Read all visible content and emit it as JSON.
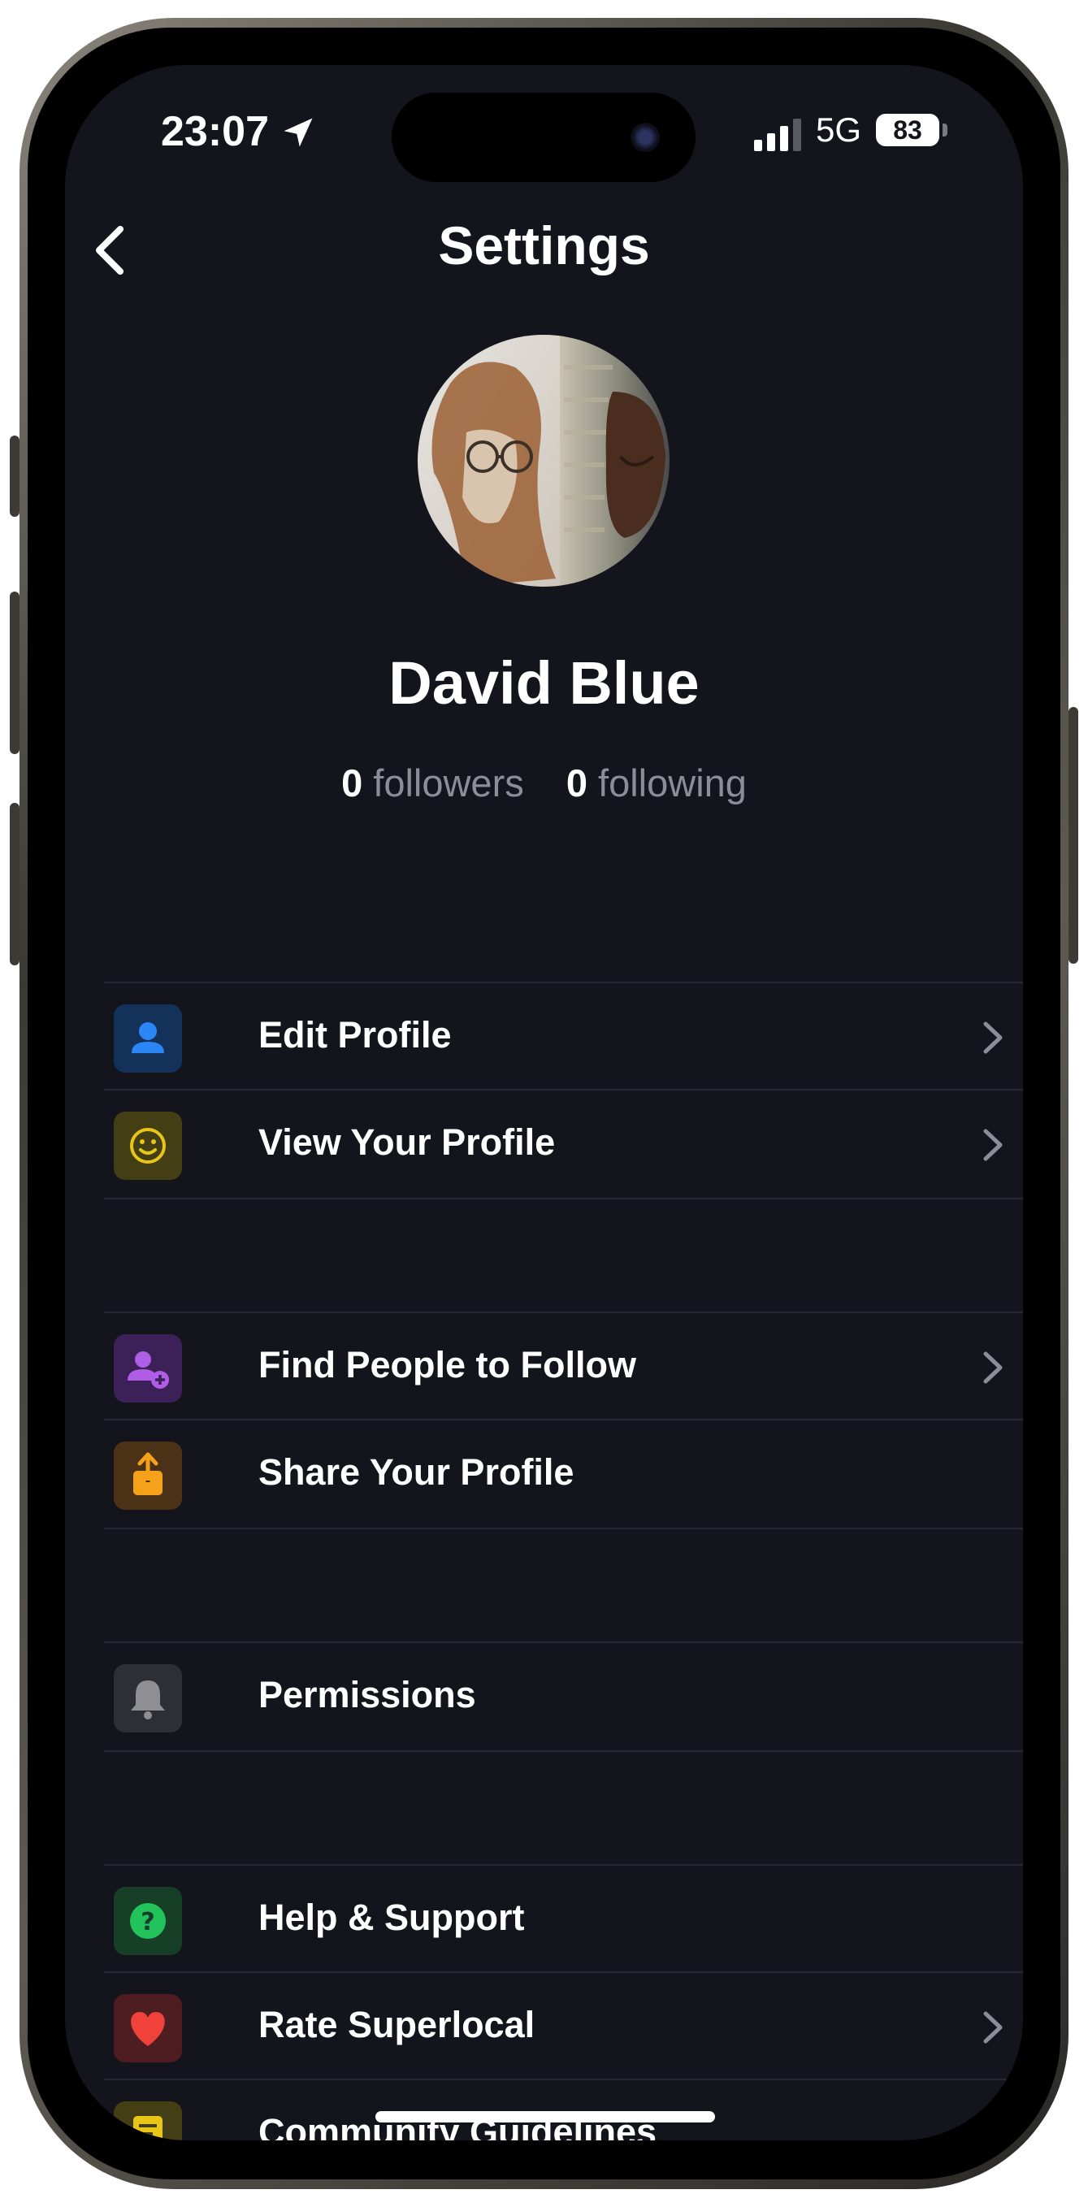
{
  "status_bar": {
    "time": "23:07",
    "network": "5G",
    "battery": "83",
    "icons": [
      "location-arrow-icon",
      "signal-bars-icon",
      "battery-icon"
    ]
  },
  "header": {
    "title": "Settings",
    "back_icon": "chevron-left-icon"
  },
  "profile": {
    "name": "David Blue",
    "followers_count": "0",
    "followers_label": "followers",
    "following_count": "0",
    "following_label": "following"
  },
  "menu": {
    "edit_profile": {
      "label": "Edit Profile",
      "icon": "person-icon",
      "icon_color": "#2d86f5",
      "has_chevron": true
    },
    "view_profile": {
      "label": "View Your Profile",
      "icon": "smiley-icon",
      "icon_color": "#e8c516",
      "has_chevron": true
    },
    "find_people": {
      "label": "Find People to Follow",
      "icon": "person-add-icon",
      "icon_color": "#b05ee6",
      "has_chevron": true
    },
    "share_profile": {
      "label": "Share Your Profile",
      "icon": "share-icon",
      "icon_color": "#f6a11a",
      "has_chevron": false
    },
    "permissions": {
      "label": "Permissions",
      "icon": "bell-icon",
      "icon_color": "#8e8e93",
      "has_chevron": false
    },
    "help_support": {
      "label": "Help & Support",
      "icon": "question-icon",
      "icon_color": "#22c35a",
      "has_chevron": false
    },
    "rate_app": {
      "label": "Rate Superlocal",
      "icon": "heart-icon",
      "icon_color": "#f0413a",
      "has_chevron": true
    },
    "community_guidelines": {
      "label": "Community Guidelines",
      "icon": "document-icon",
      "icon_color": "#e8c516",
      "has_chevron": false
    }
  }
}
